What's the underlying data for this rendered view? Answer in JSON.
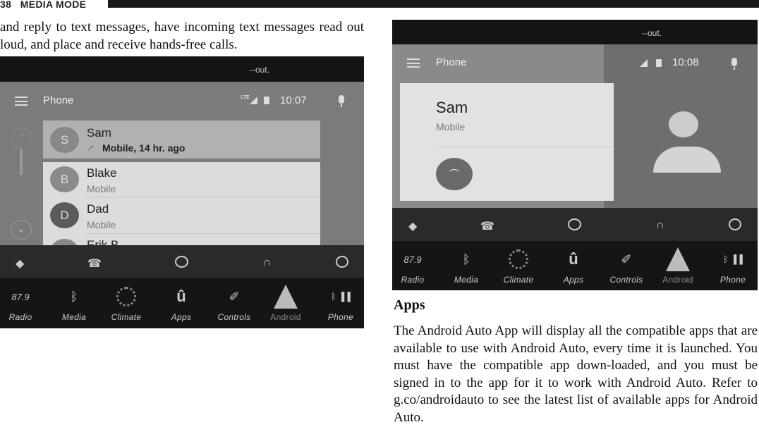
{
  "page": {
    "number": "38",
    "section": "MEDIA MODE"
  },
  "intro_text": "and reply to text messages, have incoming text messages read out loud, and place and receive hands-free calls.",
  "left_screen": {
    "status": "--out.",
    "app_title": "Phone",
    "network": "LTE",
    "time": "10:07",
    "contacts": [
      {
        "initial": "S",
        "name": "Sam",
        "detail": "Mobile, 14 hr. ago",
        "icon": "outgoing-call-arrow-icon"
      },
      {
        "initial": "B",
        "name": "Blake",
        "detail": "Mobile"
      },
      {
        "initial": "D",
        "name": "Dad",
        "detail": "Mobile"
      },
      {
        "initial": "",
        "name": "Erik B",
        "detail": ""
      }
    ]
  },
  "right_screen": {
    "status": "--out.",
    "app_title": "Phone",
    "time": "10:08",
    "caller_name": "Sam",
    "caller_detail": "Mobile"
  },
  "bottom_bar": {
    "radio_freq": "87.9",
    "items": [
      "Radio",
      "Media",
      "Climate",
      "Apps",
      "Controls",
      "Android",
      "Phone"
    ]
  },
  "apps_heading": "Apps",
  "apps_text": "The Android Auto App will display all the compatible apps that are available to use with Android Auto, every time it is launched. You must have the compatible app down-loaded, and you must be signed in to the app for it to work with Android Auto. Refer to g.co/androidauto to see the latest list of available apps for Android Auto."
}
